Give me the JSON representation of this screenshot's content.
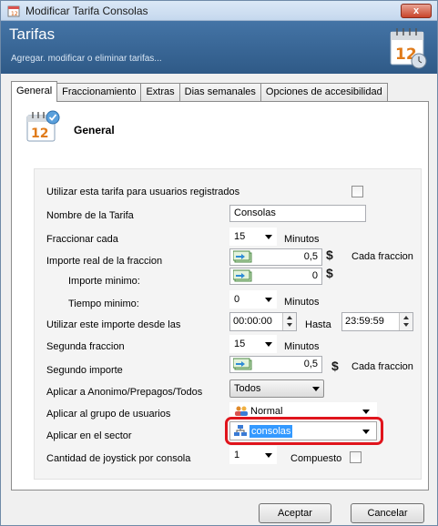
{
  "window": {
    "title": "Modificar Tarifa Consolas",
    "close_label": "x"
  },
  "banner": {
    "title": "Tarifas",
    "subtitle": "Agregar. modificar o eliminar tarifas..."
  },
  "tabs": [
    {
      "label": "General",
      "active": true
    },
    {
      "label": "Fraccionamiento"
    },
    {
      "label": "Extras"
    },
    {
      "label": "Dias semanales"
    },
    {
      "label": "Opciones de accesibilidad"
    }
  ],
  "section": {
    "title": "General"
  },
  "form": {
    "registered_users_label": "Utilizar esta tarifa para usuarios registrados",
    "name_label": "Nombre de la Tarifa",
    "name_value": "Consolas",
    "fraction_label": "Fraccionar cada",
    "fraction_value": "15",
    "fraction_unit": "Minutos",
    "real_amount_label": "Importe real de la fraccion",
    "real_amount_value": "0,5",
    "currency_symbol": "$",
    "per_fraction_label": "Cada fraccion",
    "min_amount_label": "Importe minimo:",
    "min_amount_value": "0",
    "min_time_label": "Tiempo minimo:",
    "min_time_value": "0",
    "min_time_unit": "Minutos",
    "use_from_label": "Utilizar este importe desde las",
    "use_from_value": "00:00:00",
    "until_label": "Hasta",
    "until_value": "23:59:59",
    "second_fraction_label": "Segunda fraccion",
    "second_fraction_value": "15",
    "second_fraction_unit": "Minutos",
    "second_amount_label": "Segundo importe",
    "second_amount_value": "0,5",
    "second_per_fraction_label": "Cada fraccion",
    "apply_anon_label": "Aplicar a Anonimo/Prepagos/Todos",
    "apply_anon_value": "Todos",
    "apply_group_label": "Aplicar al grupo de usuarios",
    "apply_group_value": "Normal",
    "apply_sector_label": "Aplicar en el sector",
    "apply_sector_value": "consolas",
    "joystick_label": "Cantidad de joystick por consola",
    "joystick_value": "1",
    "compound_label": "Compuesto"
  },
  "buttons": {
    "accept": "Aceptar",
    "cancel": "Cancelar"
  }
}
